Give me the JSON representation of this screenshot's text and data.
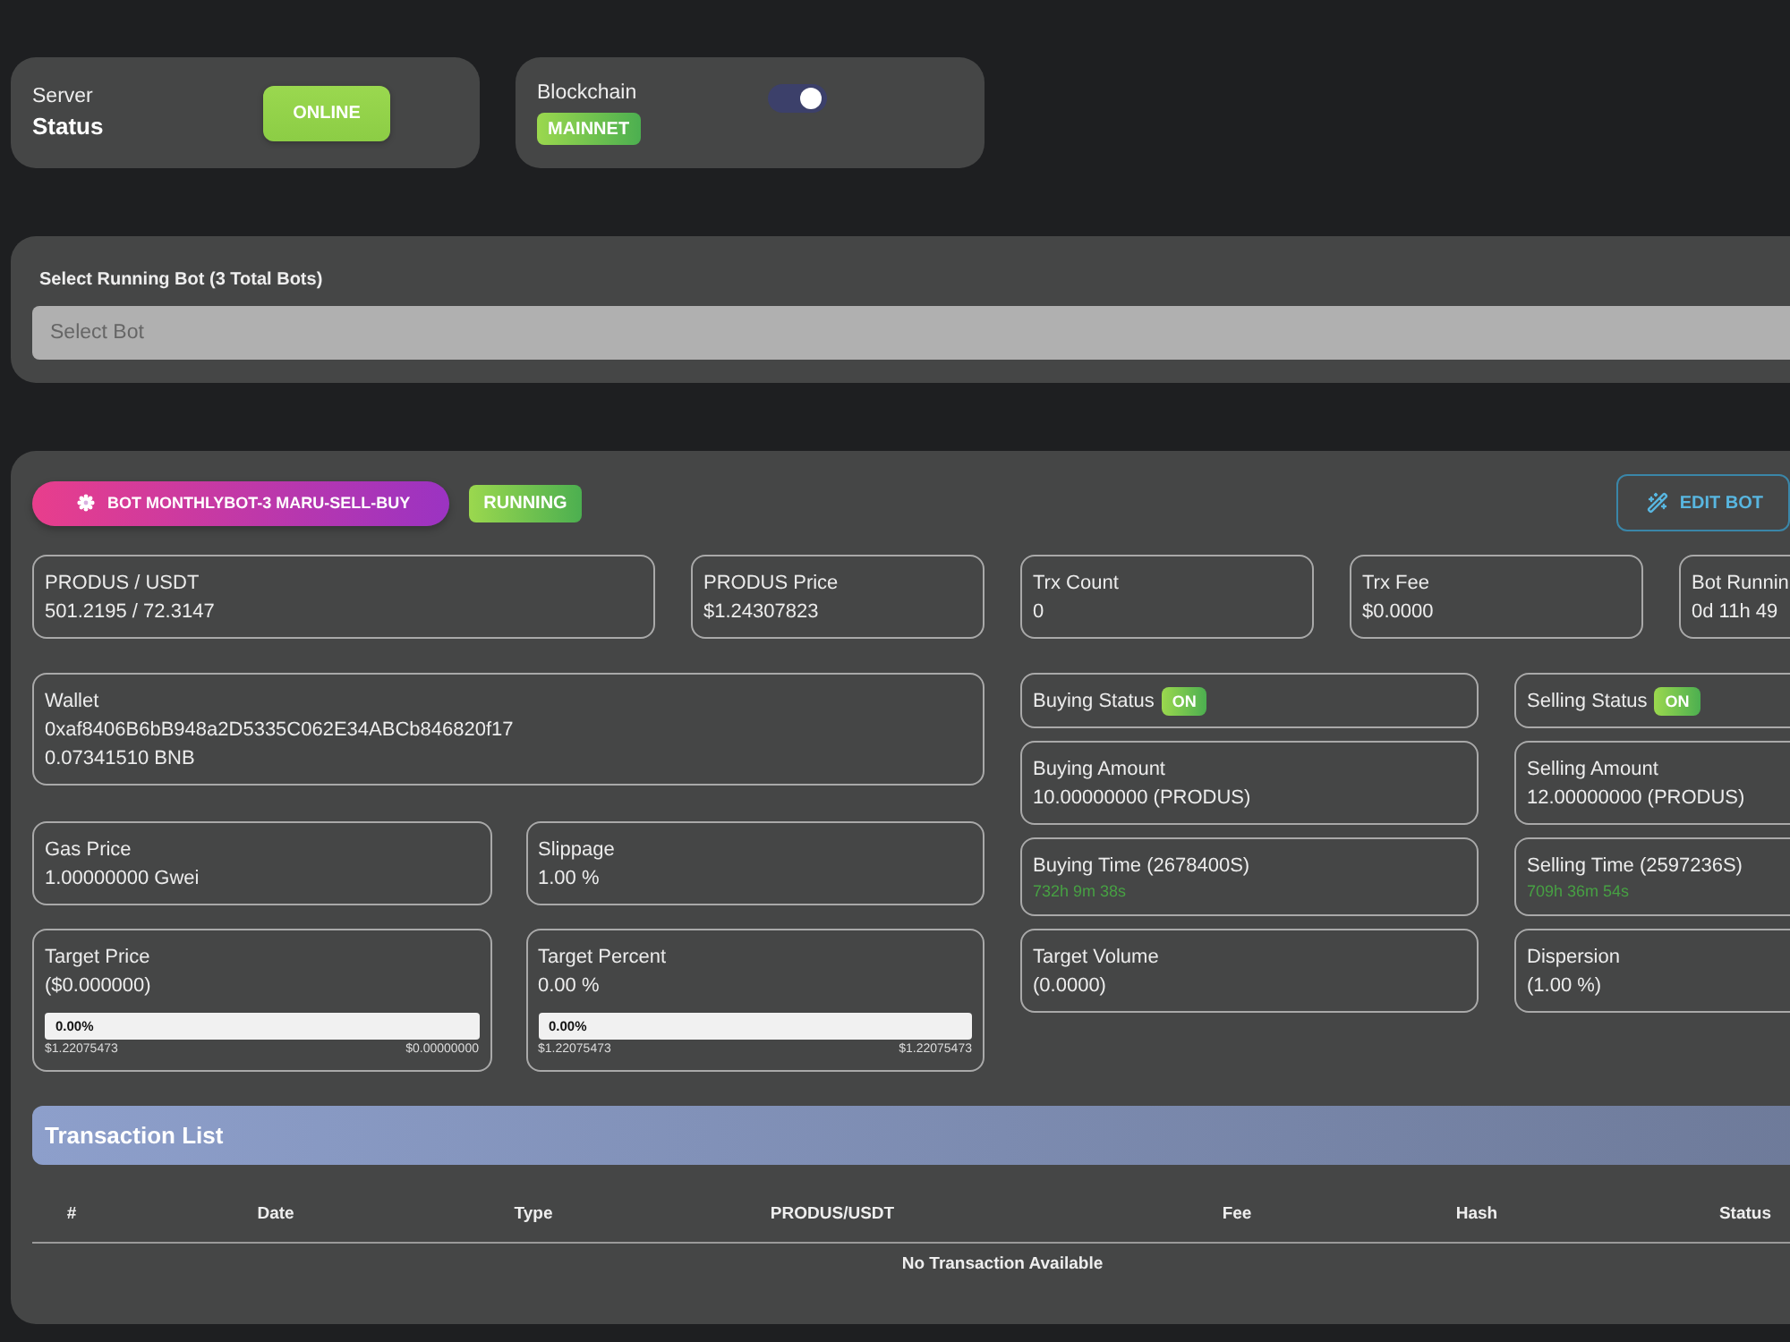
{
  "server": {
    "label": "Server",
    "title": "Status",
    "status": "ONLINE"
  },
  "blockchain": {
    "label": "Blockchain",
    "network": "MAINNET",
    "toggle_on": true
  },
  "bot_select": {
    "label": "Select Running Bot (3 Total Bots)",
    "placeholder": "Select Bot"
  },
  "bot": {
    "name": "BOT MONTHLYBOT-3 MARU-SELL-BUY",
    "status": "RUNNING",
    "edit_button": "EDIT BOT"
  },
  "stats": [
    {
      "label": "PRODUS / USDT",
      "value": "501.2195 / 72.3147"
    },
    {
      "label": "PRODUS Price",
      "value": "$1.24307823"
    },
    {
      "label": "Trx Count",
      "value": "0"
    },
    {
      "label": "Trx Fee",
      "value": "$0.0000"
    },
    {
      "label": "Bot Runnin",
      "value": "0d 11h 49"
    }
  ],
  "wallet": {
    "label": "Wallet",
    "address": "0xaf8406B6bB948a2D5335C062E34ABCb846820f17",
    "balance": "0.07341510 BNB"
  },
  "settings": [
    {
      "label": "Gas Price",
      "value": "1.00000000 Gwei"
    },
    {
      "label": "Slippage",
      "value": "1.00 %"
    }
  ],
  "targets": [
    {
      "label": "Target Price",
      "value": "($0.000000)",
      "progress": {
        "level": 0,
        "text": "0.00%",
        "left_label": "$1.22075473",
        "right_label": "$0.00000000"
      }
    },
    {
      "label": "Target Percent",
      "value": "0.00 %",
      "progress": {
        "level": 0,
        "text": "0.00%",
        "left_label": "$1.22075473",
        "right_label": "$1.22075473"
      }
    }
  ],
  "buying": [
    {
      "kind": "status",
      "label": "Buying Status",
      "on": true,
      "badge": "ON"
    },
    {
      "kind": "value",
      "label": "Buying Amount",
      "value": "10.00000000 (PRODUS)"
    },
    {
      "kind": "timer",
      "label": "Buying Time (2678400S)",
      "value": "732h 9m 38s"
    },
    {
      "kind": "value",
      "label": "Target Volume",
      "value": "(0.0000)"
    }
  ],
  "selling": [
    {
      "kind": "status",
      "label": "Selling Status",
      "on": true,
      "badge": "ON"
    },
    {
      "kind": "value",
      "label": "Selling Amount",
      "value": "12.00000000 (PRODUS)"
    },
    {
      "kind": "timer",
      "label": "Selling Time (2597236S)",
      "value": "709h 36m 54s"
    },
    {
      "kind": "value",
      "label": "Dispersion",
      "value": "(1.00 %)"
    }
  ],
  "transactions": {
    "title": "Transaction List",
    "columns": [
      "#",
      "Date",
      "Type",
      "PRODUS/USDT",
      "Fee",
      "Hash",
      "Status"
    ],
    "empty_message": "No Transaction Available"
  }
}
